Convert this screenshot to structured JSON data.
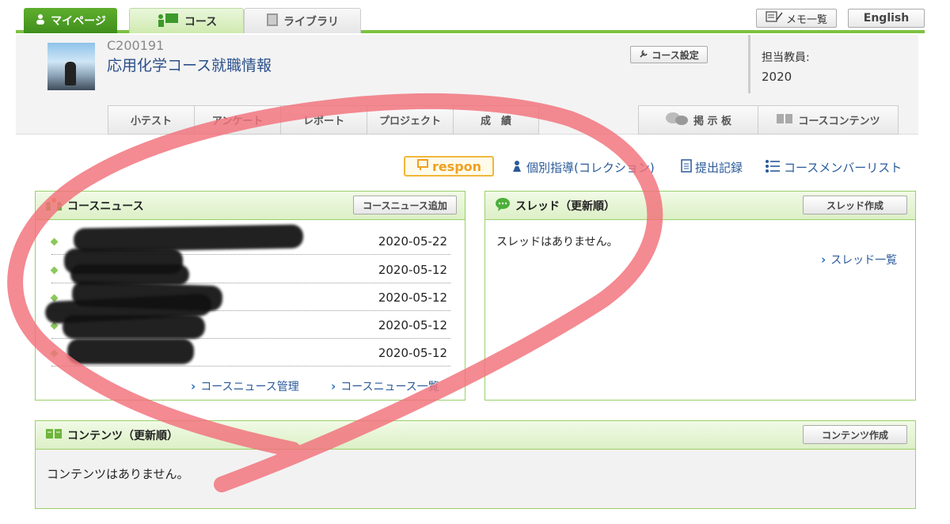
{
  "topnav": {
    "mypage": "マイページ",
    "course": "コース",
    "library": "ライブラリ",
    "memo": "メモ一覧",
    "english": "English"
  },
  "course": {
    "code": "C200191",
    "name": "応用化学コース就職情報",
    "settings": "コース設定",
    "teacher_label": "担当教員:",
    "teacher_value": "2020"
  },
  "subtabs": [
    "小テスト",
    "アンケート",
    "レポート",
    "プロジェクト",
    "成　績"
  ],
  "rtabs": {
    "board": "掲 示 板",
    "contents": "コースコンテンツ"
  },
  "links": {
    "respon": "respon",
    "individual": "個別指導(コレクション)",
    "submissions": "提出記録",
    "members": "コースメンバーリスト"
  },
  "news": {
    "title": "コースニュース",
    "add": "コースニュース追加",
    "items": [
      {
        "date": "2020-05-22"
      },
      {
        "date": "2020-05-12"
      },
      {
        "date": "2020-05-12"
      },
      {
        "date": "2020-05-12"
      },
      {
        "date": "2020-05-12"
      }
    ],
    "manage": "コースニュース管理",
    "list": "コースニュース一覧"
  },
  "threads": {
    "title": "スレッド（更新順）",
    "create": "スレッド作成",
    "empty": "スレッドはありません。",
    "list": "スレッド一覧"
  },
  "contents": {
    "title": "コンテンツ（更新順）",
    "create": "コンテンツ作成",
    "empty": "コンテンツはありません。"
  },
  "colors": {
    "accent": "#7cc241",
    "link": "#2a5a9a",
    "annotation": "#f2707a"
  }
}
